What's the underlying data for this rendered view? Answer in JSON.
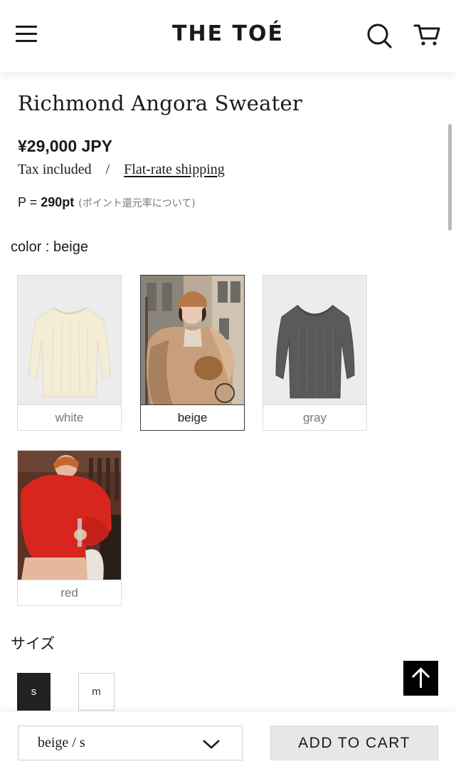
{
  "header": {
    "logo": "THE TOÉ",
    "menu_icon": "hamburger-menu-icon",
    "search_icon": "search-icon",
    "cart_icon": "cart-icon"
  },
  "product": {
    "title": "Richmond Angora Sweater",
    "price": "¥29,000 JPY",
    "tax_text": "Tax included",
    "separator": "/",
    "shipping_link": "Flat-rate shipping",
    "points_prefix": "P = ",
    "points_value": "290pt",
    "points_note": "(ポイント還元率について)"
  },
  "color": {
    "label": "color : beige",
    "options": [
      {
        "name": "white",
        "selected": false,
        "image": "white-sweater-product-photo"
      },
      {
        "name": "beige",
        "selected": true,
        "image": "beige-sweater-model-photo"
      },
      {
        "name": "gray",
        "selected": false,
        "image": "gray-sweater-product-photo"
      },
      {
        "name": "red",
        "selected": false,
        "image": "red-sweater-model-photo"
      }
    ]
  },
  "size": {
    "label": "サイズ",
    "options": [
      {
        "name": "s",
        "selected": true
      },
      {
        "name": "m",
        "selected": false
      }
    ]
  },
  "scroll_top_icon": "arrow-up-icon",
  "footer": {
    "variant_value": "beige / s",
    "dropdown_icon": "chevron-down-icon",
    "add_to_cart": "ADD TO CART"
  },
  "colors": {
    "text": "#1a1a1a",
    "selected_size_bg": "#222222",
    "add_to_cart_bg": "#e7e7e7",
    "beige_swatch": "#e6c9a8",
    "red_swatch": "#d8261f"
  }
}
